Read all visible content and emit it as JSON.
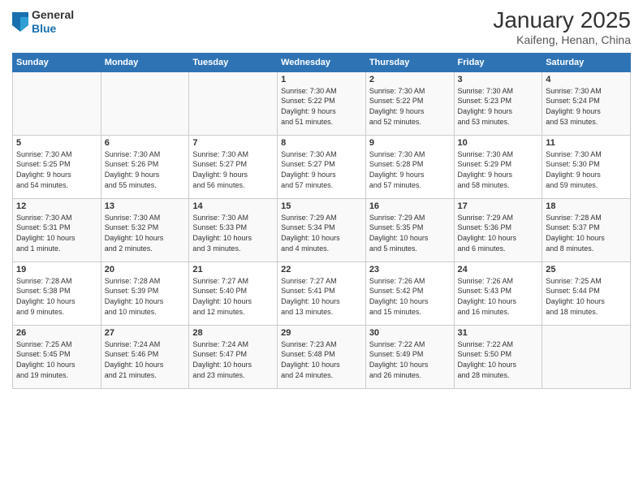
{
  "header": {
    "logo_general": "General",
    "logo_blue": "Blue",
    "title": "January 2025",
    "subtitle": "Kaifeng, Henan, China"
  },
  "days_of_week": [
    "Sunday",
    "Monday",
    "Tuesday",
    "Wednesday",
    "Thursday",
    "Friday",
    "Saturday"
  ],
  "weeks": [
    [
      {
        "day": "",
        "info": ""
      },
      {
        "day": "",
        "info": ""
      },
      {
        "day": "",
        "info": ""
      },
      {
        "day": "1",
        "info": "Sunrise: 7:30 AM\nSunset: 5:22 PM\nDaylight: 9 hours\nand 51 minutes."
      },
      {
        "day": "2",
        "info": "Sunrise: 7:30 AM\nSunset: 5:22 PM\nDaylight: 9 hours\nand 52 minutes."
      },
      {
        "day": "3",
        "info": "Sunrise: 7:30 AM\nSunset: 5:23 PM\nDaylight: 9 hours\nand 53 minutes."
      },
      {
        "day": "4",
        "info": "Sunrise: 7:30 AM\nSunset: 5:24 PM\nDaylight: 9 hours\nand 53 minutes."
      }
    ],
    [
      {
        "day": "5",
        "info": "Sunrise: 7:30 AM\nSunset: 5:25 PM\nDaylight: 9 hours\nand 54 minutes."
      },
      {
        "day": "6",
        "info": "Sunrise: 7:30 AM\nSunset: 5:26 PM\nDaylight: 9 hours\nand 55 minutes."
      },
      {
        "day": "7",
        "info": "Sunrise: 7:30 AM\nSunset: 5:27 PM\nDaylight: 9 hours\nand 56 minutes."
      },
      {
        "day": "8",
        "info": "Sunrise: 7:30 AM\nSunset: 5:27 PM\nDaylight: 9 hours\nand 57 minutes."
      },
      {
        "day": "9",
        "info": "Sunrise: 7:30 AM\nSunset: 5:28 PM\nDaylight: 9 hours\nand 57 minutes."
      },
      {
        "day": "10",
        "info": "Sunrise: 7:30 AM\nSunset: 5:29 PM\nDaylight: 9 hours\nand 58 minutes."
      },
      {
        "day": "11",
        "info": "Sunrise: 7:30 AM\nSunset: 5:30 PM\nDaylight: 9 hours\nand 59 minutes."
      }
    ],
    [
      {
        "day": "12",
        "info": "Sunrise: 7:30 AM\nSunset: 5:31 PM\nDaylight: 10 hours\nand 1 minute."
      },
      {
        "day": "13",
        "info": "Sunrise: 7:30 AM\nSunset: 5:32 PM\nDaylight: 10 hours\nand 2 minutes."
      },
      {
        "day": "14",
        "info": "Sunrise: 7:30 AM\nSunset: 5:33 PM\nDaylight: 10 hours\nand 3 minutes."
      },
      {
        "day": "15",
        "info": "Sunrise: 7:29 AM\nSunset: 5:34 PM\nDaylight: 10 hours\nand 4 minutes."
      },
      {
        "day": "16",
        "info": "Sunrise: 7:29 AM\nSunset: 5:35 PM\nDaylight: 10 hours\nand 5 minutes."
      },
      {
        "day": "17",
        "info": "Sunrise: 7:29 AM\nSunset: 5:36 PM\nDaylight: 10 hours\nand 6 minutes."
      },
      {
        "day": "18",
        "info": "Sunrise: 7:28 AM\nSunset: 5:37 PM\nDaylight: 10 hours\nand 8 minutes."
      }
    ],
    [
      {
        "day": "19",
        "info": "Sunrise: 7:28 AM\nSunset: 5:38 PM\nDaylight: 10 hours\nand 9 minutes."
      },
      {
        "day": "20",
        "info": "Sunrise: 7:28 AM\nSunset: 5:39 PM\nDaylight: 10 hours\nand 10 minutes."
      },
      {
        "day": "21",
        "info": "Sunrise: 7:27 AM\nSunset: 5:40 PM\nDaylight: 10 hours\nand 12 minutes."
      },
      {
        "day": "22",
        "info": "Sunrise: 7:27 AM\nSunset: 5:41 PM\nDaylight: 10 hours\nand 13 minutes."
      },
      {
        "day": "23",
        "info": "Sunrise: 7:26 AM\nSunset: 5:42 PM\nDaylight: 10 hours\nand 15 minutes."
      },
      {
        "day": "24",
        "info": "Sunrise: 7:26 AM\nSunset: 5:43 PM\nDaylight: 10 hours\nand 16 minutes."
      },
      {
        "day": "25",
        "info": "Sunrise: 7:25 AM\nSunset: 5:44 PM\nDaylight: 10 hours\nand 18 minutes."
      }
    ],
    [
      {
        "day": "26",
        "info": "Sunrise: 7:25 AM\nSunset: 5:45 PM\nDaylight: 10 hours\nand 19 minutes."
      },
      {
        "day": "27",
        "info": "Sunrise: 7:24 AM\nSunset: 5:46 PM\nDaylight: 10 hours\nand 21 minutes."
      },
      {
        "day": "28",
        "info": "Sunrise: 7:24 AM\nSunset: 5:47 PM\nDaylight: 10 hours\nand 23 minutes."
      },
      {
        "day": "29",
        "info": "Sunrise: 7:23 AM\nSunset: 5:48 PM\nDaylight: 10 hours\nand 24 minutes."
      },
      {
        "day": "30",
        "info": "Sunrise: 7:22 AM\nSunset: 5:49 PM\nDaylight: 10 hours\nand 26 minutes."
      },
      {
        "day": "31",
        "info": "Sunrise: 7:22 AM\nSunset: 5:50 PM\nDaylight: 10 hours\nand 28 minutes."
      },
      {
        "day": "",
        "info": ""
      }
    ]
  ]
}
